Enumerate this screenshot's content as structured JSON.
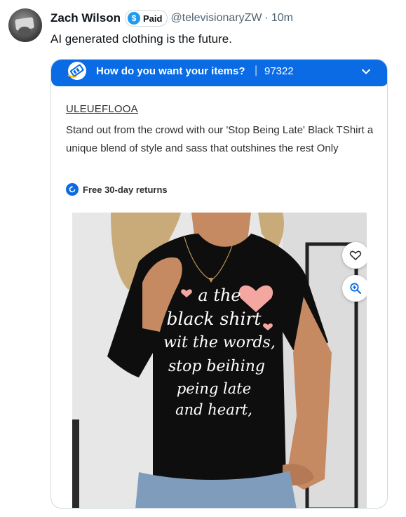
{
  "tweet": {
    "author_name": "Zach Wilson",
    "paid_badge": "Paid",
    "paid_icon": "$",
    "handle": "@televisionaryZW",
    "separator": "·",
    "time": "10m",
    "text": "AI generated clothing is the future."
  },
  "card": {
    "banner": {
      "question": "How do you want your items?",
      "separator": "|",
      "zip": "97322",
      "color": "#0a6be4"
    },
    "brand": "ULEUEFLOOA",
    "description": "Stand out from the crowd with our 'Stop Being Late' Black TShirt a unique blend of style and sass that outshines the rest Only",
    "returns": "Free 30-day returns",
    "shirt_text": {
      "line1": "a the",
      "line2": "black shirt",
      "line3": "wit the words,",
      "line4": "stop beihing",
      "line5": "peing late",
      "line6": "and heart,"
    }
  },
  "colors": {
    "accent_blue": "#1d9bf0",
    "walmart_blue": "#0a6be4",
    "heart_pink": "#f4a7a0"
  }
}
